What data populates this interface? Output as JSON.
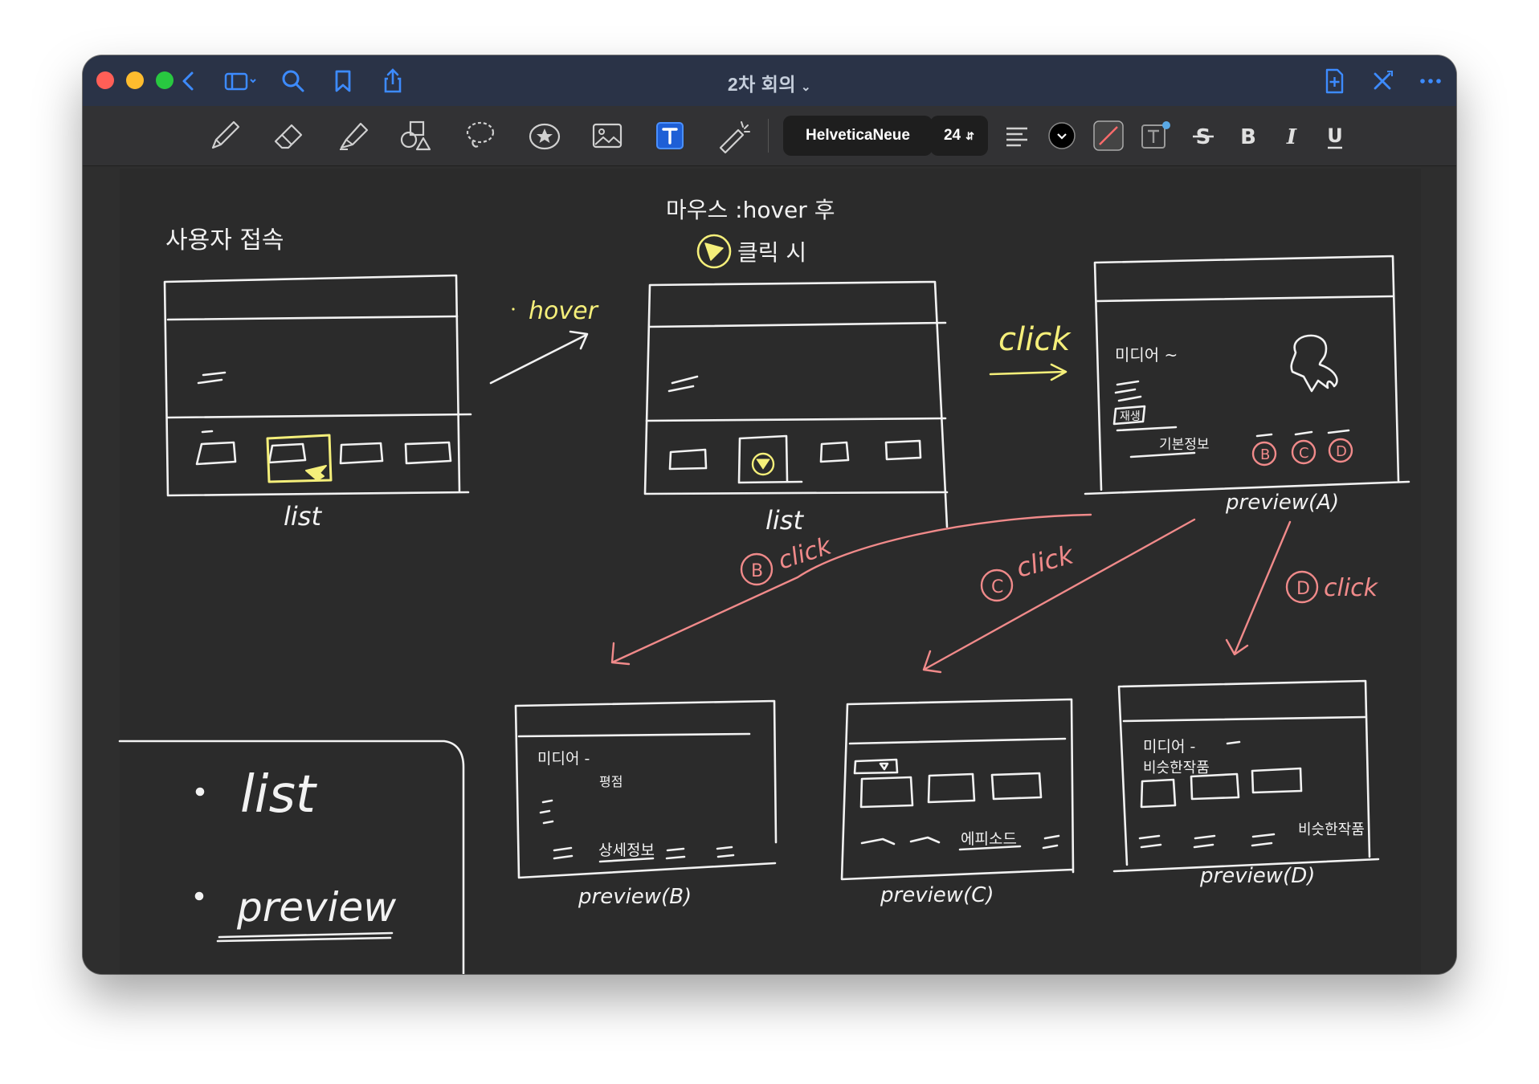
{
  "window": {
    "title": "2차 회의",
    "title_chevron": "⌄"
  },
  "toolbar": {
    "font_name": "HelveticaNeue",
    "font_size": "24"
  },
  "sketch": {
    "user_access": "사용자 접속",
    "hover_label": "hover",
    "list_label_1": "list",
    "mouse_hover": "마우스 :hover 후",
    "click_when": "클릭 시",
    "list_label_2": "list",
    "click_top": "click",
    "media_title": "미디어 ~",
    "play": "재생",
    "basic_info": "기본정보",
    "preview_a": "preview(A)",
    "b_click": "click",
    "c_click": "click",
    "d_click": "click",
    "b_letter": "B",
    "c_letter": "C",
    "d_letter": "D",
    "b_media": "미디어 -",
    "b_rating": "평점",
    "b_detail": "상세정보",
    "preview_b": "preview(B)",
    "c_episode": "에피소드",
    "preview_c": "preview(C)",
    "d_media": "미디어 -",
    "d_similar": "비슷한작품",
    "d_similar2": "비슷한작품",
    "preview_d": "preview(D)",
    "legend_list": "list",
    "legend_preview": "preview"
  },
  "colors": {
    "titlebar": "#2a3347",
    "toolbar": "#323234",
    "canvas": "#2b2b2b",
    "ink_white": "#f2f2f2",
    "ink_yellow": "#f5ef7a",
    "ink_pink": "#f08a8a",
    "accent_blue": "#3d8bff"
  }
}
